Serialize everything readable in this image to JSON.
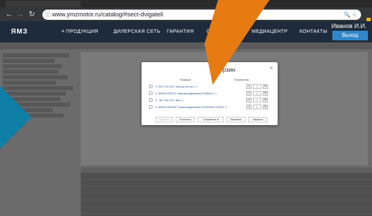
{
  "browser": {
    "url": "www.ymzmotor.ru/catalog/#sect-dvigateli",
    "colors": {
      "arrow": "#e87a12",
      "teal": "#0f7fa8",
      "header": "#1e2b3c",
      "logout": "#2f86c9"
    }
  },
  "site": {
    "logo": "ЯМЗ",
    "nav": [
      "≡ ПРОДУКЦИЯ",
      "ДИЛЕРСКАЯ СЕТЬ",
      "ГАРАНТИЯ",
      "О К",
      "МЕДИАЦЕНТР",
      "КОНТАКТЫ"
    ],
    "user": "Иванов И.И.",
    "logout": "Выход"
  },
  "cart": {
    "title": "Корзин",
    "col_position": "Позиция",
    "col_qty": "Количество",
    "items": [
      {
        "name": "1. 50С 215 413. Кольцо уплотн. 1",
        "qty": "1"
      },
      {
        "name": "2. 800000 00473. Шарикоподшипник 6328МС3. 1",
        "qty": "1"
      },
      {
        "name": "3. 7БС 351 321. Вал. 1",
        "qty": "1"
      },
      {
        "name": "4. 800000 00226. Роликоподшипник NU2030EC/VK301. 1",
        "qty": "1"
      }
    ],
    "buttons": {
      "delete": "Удалить",
      "clear": "Очистить",
      "save": "Сохранить ▾",
      "order": "Заказать",
      "close": "Закрыть"
    }
  }
}
